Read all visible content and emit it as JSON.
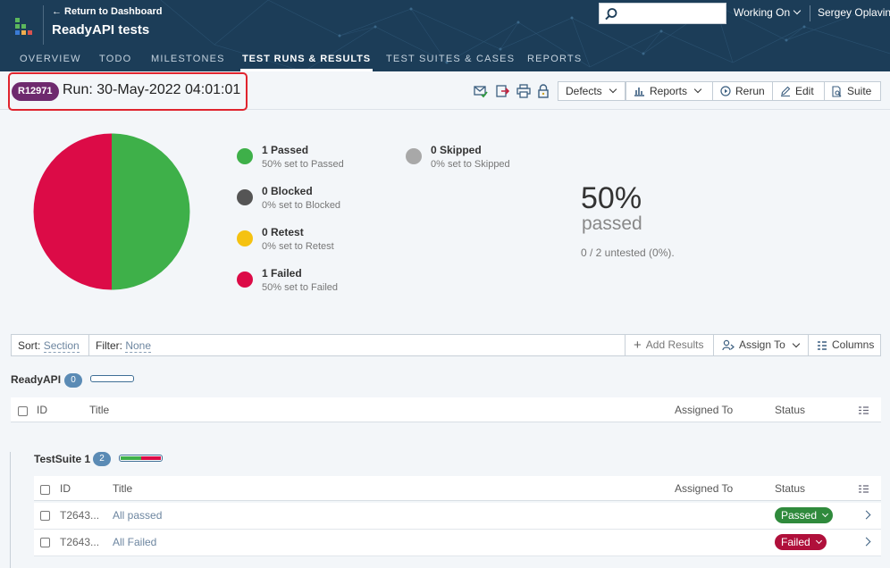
{
  "header": {
    "back_link": "← Return to Dashboard",
    "project_title": "ReadyAPI tests",
    "search_placeholder": "",
    "working_status": "Working On",
    "user_name": "Sergey Oplavin",
    "background_color": "#1c3d58"
  },
  "tabs": [
    {
      "label": "OVERVIEW",
      "active": false
    },
    {
      "label": "TODO",
      "active": false
    },
    {
      "label": "MILESTONES",
      "active": false
    },
    {
      "label": "TEST RUNS & RESULTS",
      "active": true
    },
    {
      "label": "TEST SUITES & CASES",
      "active": false
    },
    {
      "label": "REPORTS",
      "active": false
    }
  ],
  "run": {
    "badge": "R12971",
    "title": "Run: 30-May-2022 04:01:01",
    "badge_color": "#6e2a6e",
    "toolbar_icons": [
      "email-check-icon",
      "export-icon",
      "print-icon",
      "lock-icon"
    ],
    "buttons": {
      "defects": "Defects",
      "reports": "Reports",
      "rerun": "Rerun",
      "edit": "Edit",
      "suite": "Suite"
    }
  },
  "stats": {
    "legend": [
      {
        "title": "1 Passed",
        "sub": "50% set to Passed",
        "color": "#3eb049"
      },
      {
        "title": "0 Blocked",
        "sub": "0% set to Blocked",
        "color": "#555555"
      },
      {
        "title": "0 Retest",
        "sub": "0% set to Retest",
        "color": "#f5c211"
      },
      {
        "title": "1 Failed",
        "sub": "50% set to Failed",
        "color": "#dc0b47"
      },
      {
        "title": "0 Skipped",
        "sub": "0% set to Skipped",
        "color": "#a8a8a8"
      }
    ],
    "pie": {
      "passed": 1,
      "failed": 1,
      "passed_color": "#3eb049",
      "failed_color": "#dc0b47"
    },
    "percent": "50%",
    "percent_label": "passed",
    "untested": "0 / 2 untested (0%)."
  },
  "sortbar": {
    "sort_label": "Sort:",
    "sort_value": "Section",
    "filter_label": "Filter:",
    "filter_value": "None",
    "add_results": "Add Results",
    "assign_to": "Assign To",
    "columns": "Columns"
  },
  "sections": [
    {
      "name": "ReadyAPI",
      "count": "0",
      "columns": {
        "id": "ID",
        "title": "Title",
        "assigned": "Assigned To",
        "status": "Status"
      },
      "progress": {
        "passed": 0,
        "failed": 0
      },
      "rows": []
    },
    {
      "name": "TestSuite 1",
      "count": "2",
      "columns": {
        "id": "ID",
        "title": "Title",
        "assigned": "Assigned To",
        "status": "Status"
      },
      "progress": {
        "passed": 0.5,
        "failed": 0.5
      },
      "rows": [
        {
          "id": "T2643...",
          "title": "All passed",
          "assigned": "",
          "status": "Passed",
          "status_color": "#2f8a3c"
        },
        {
          "id": "T2643...",
          "title": "All Failed",
          "assigned": "",
          "status": "Failed",
          "status_color": "#b0103b"
        }
      ]
    }
  ]
}
